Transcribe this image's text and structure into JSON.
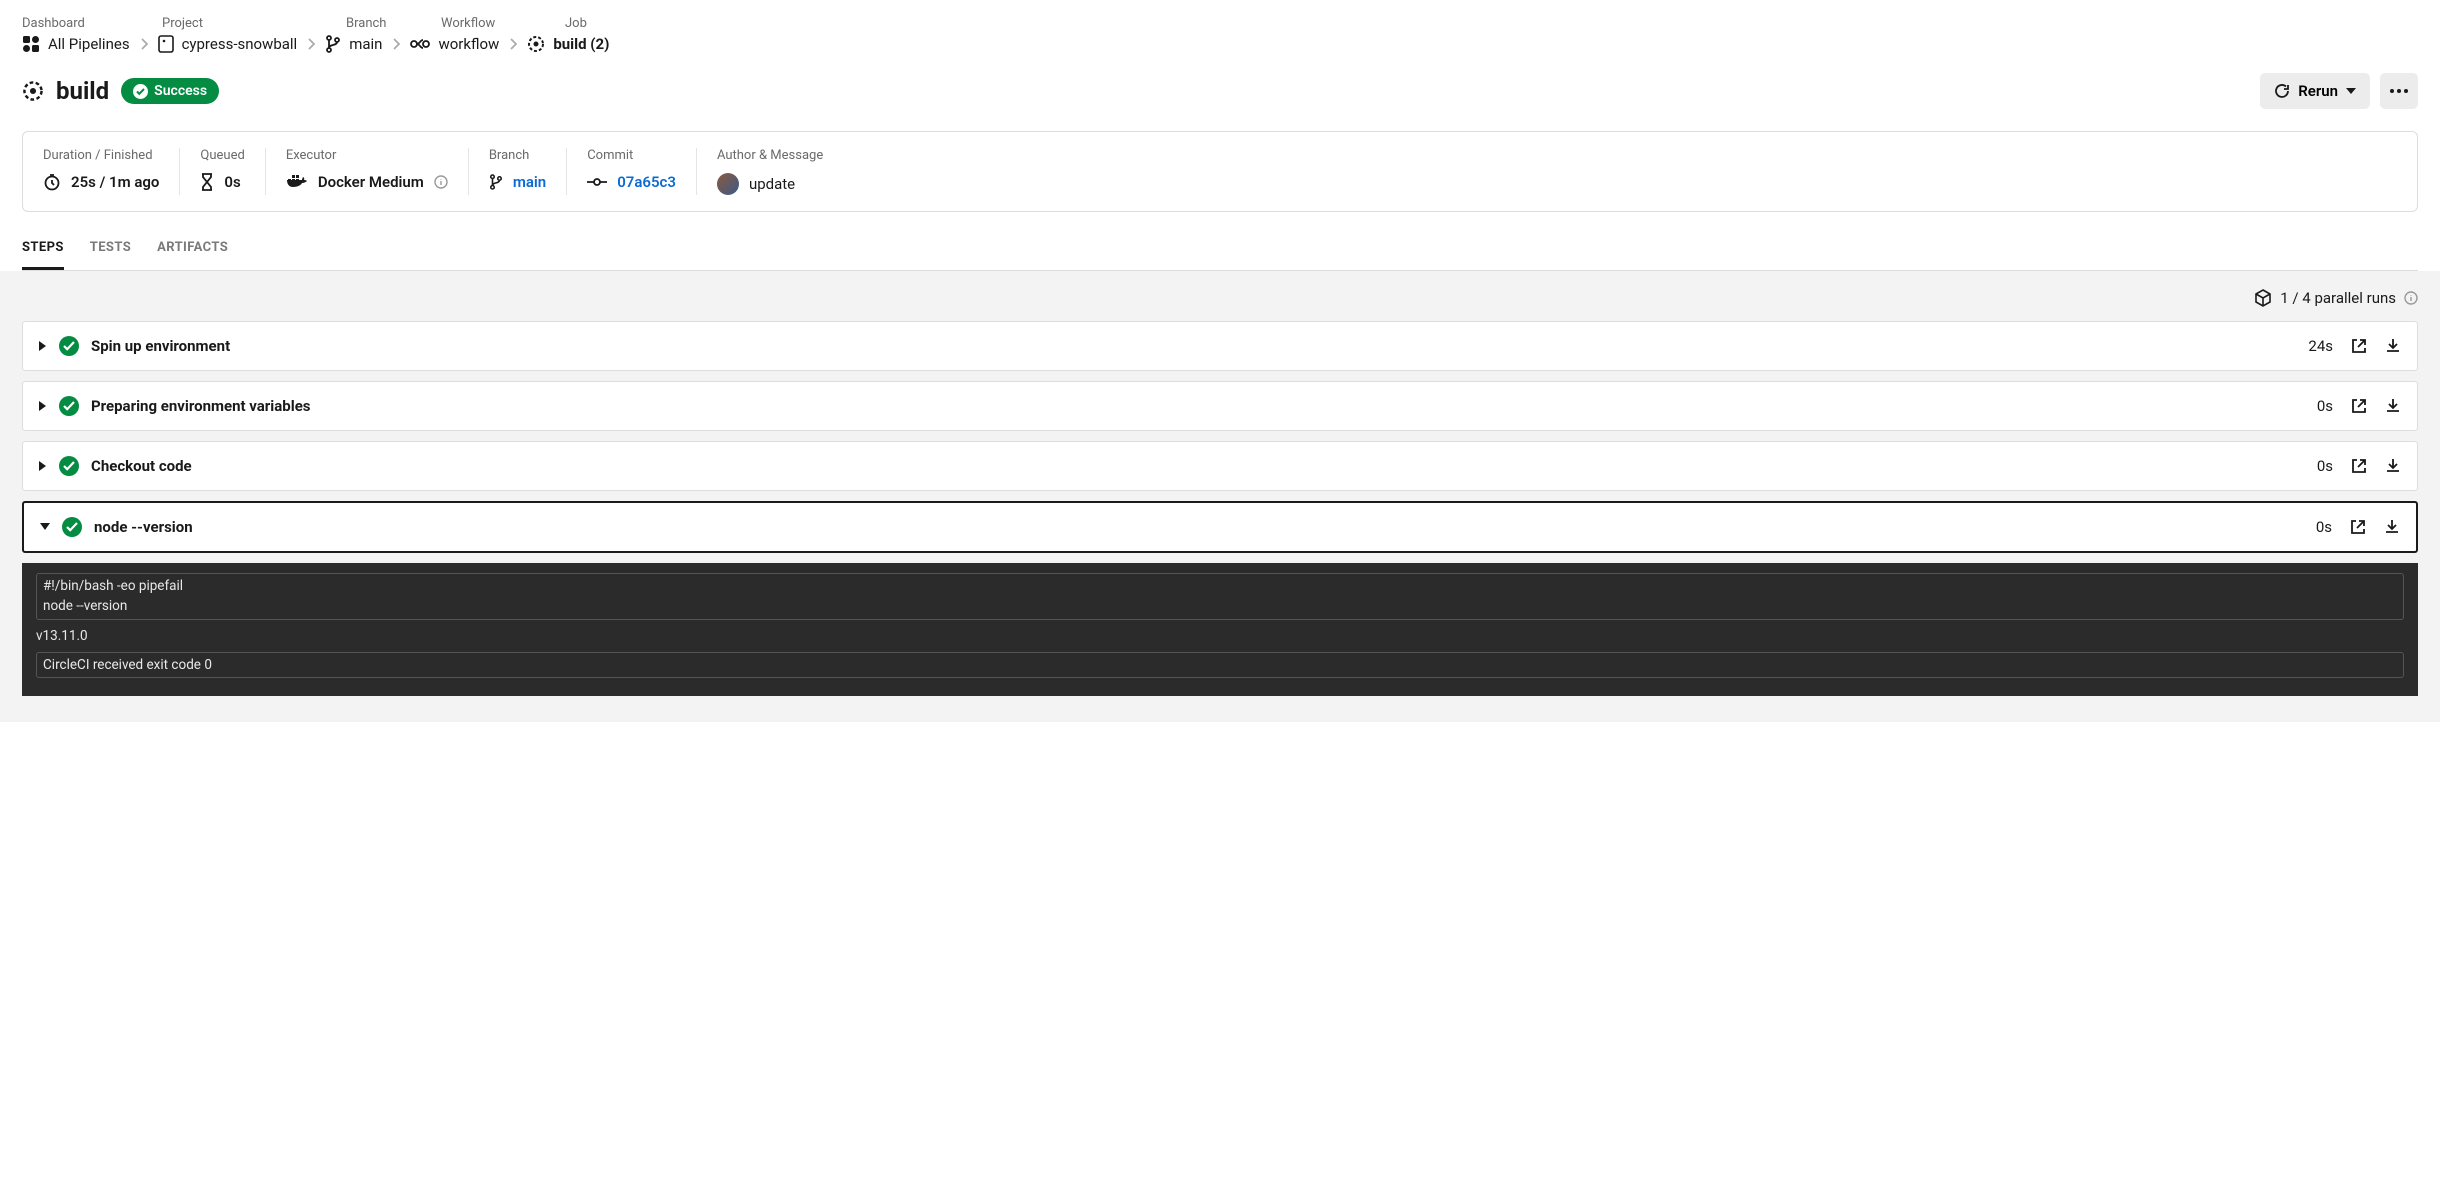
{
  "breadcrumb_labels": {
    "dashboard": "Dashboard",
    "project": "Project",
    "branch": "Branch",
    "workflow": "Workflow",
    "job": "Job"
  },
  "breadcrumb": {
    "all_pipelines": "All Pipelines",
    "project": "cypress-snowball",
    "branch": "main",
    "workflow": "workflow",
    "job": "build (2)"
  },
  "title": "build",
  "status": "Success",
  "actions": {
    "rerun": "Rerun"
  },
  "summary": {
    "duration_label": "Duration / Finished",
    "duration": "25s / 1m ago",
    "queued_label": "Queued",
    "queued": "0s",
    "executor_label": "Executor",
    "executor": "Docker Medium",
    "branch_label": "Branch",
    "branch": "main",
    "commit_label": "Commit",
    "commit": "07a65c3",
    "author_label": "Author & Message",
    "message": "update"
  },
  "tabs": {
    "steps": "STEPS",
    "tests": "TESTS",
    "artifacts": "ARTIFACTS"
  },
  "parallel_runs": "1 / 4 parallel runs",
  "steps": [
    {
      "name": "Spin up environment",
      "time": "24s"
    },
    {
      "name": "Preparing environment variables",
      "time": "0s"
    },
    {
      "name": "Checkout code",
      "time": "0s"
    },
    {
      "name": "node --version",
      "time": "0s"
    }
  ],
  "terminal": {
    "cmd": "#!/bin/bash -eo pipefail\nnode --version",
    "out": "v13.11.0",
    "exit": "CircleCI received exit code 0"
  }
}
